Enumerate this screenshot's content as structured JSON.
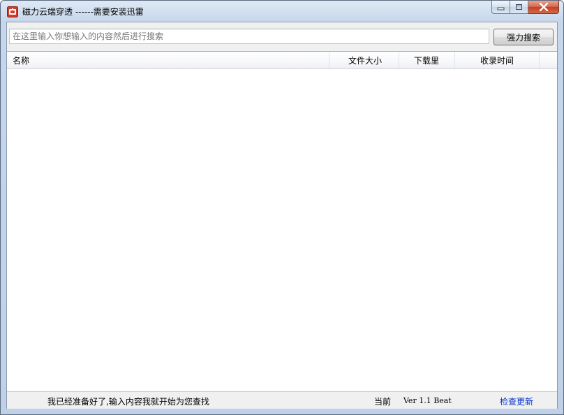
{
  "window": {
    "title": "磁力云端穿透 ------需要安装迅雷",
    "icon": "magnet-app-icon",
    "controls": [
      "minimize-icon",
      "maximize-icon",
      "close-icon"
    ]
  },
  "search": {
    "placeholder": "在这里输入你想输入的内容然后进行搜索",
    "value": "",
    "button_label": "强力搜索"
  },
  "list": {
    "columns": [
      "名称",
      "文件大小",
      "下载里",
      "收录时间"
    ],
    "rows": []
  },
  "status": {
    "message": "我已经准备好了,输入内容我就开始为您查找",
    "current_label": "当前",
    "version": "Ver 1.1 Beat",
    "update_link": "检查更新"
  },
  "colors": {
    "link": "#0033cc",
    "close_button": "#c3401f",
    "app_icon": "#d23a2a"
  }
}
